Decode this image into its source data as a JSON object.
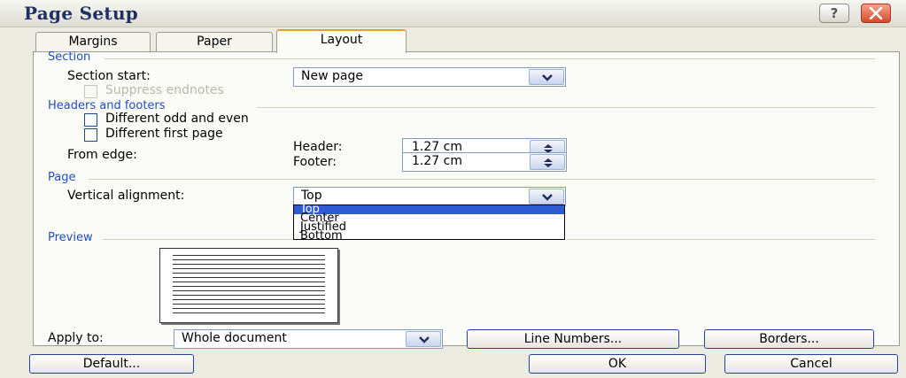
{
  "window": {
    "title": "Page Setup",
    "help_icon": "?"
  },
  "tabs": [
    {
      "label": "Margins"
    },
    {
      "label": "Paper"
    },
    {
      "label": "Layout"
    }
  ],
  "section": {
    "title": "Section",
    "section_start_label": "Section start:",
    "section_start_value": "New page",
    "suppress_endnotes_label": "Suppress endnotes"
  },
  "headers_footers": {
    "title": "Headers and footers",
    "odd_even_label": "Different odd and even",
    "first_page_label": "Different first page",
    "from_edge_label": "From edge:",
    "header_label": "Header:",
    "header_value": "1.27 cm",
    "footer_label": "Footer:",
    "footer_value": "1.27 cm"
  },
  "page": {
    "title": "Page",
    "vertical_alignment_label": "Vertical alignment:",
    "vertical_alignment_value": "Top",
    "options": [
      "Top",
      "Center",
      "Justified",
      "Bottom"
    ]
  },
  "preview": {
    "title": "Preview",
    "apply_to_label": "Apply to:",
    "apply_to_value": "Whole document",
    "line_numbers_button": "Line Numbers...",
    "borders_button": "Borders..."
  },
  "footer_buttons": {
    "default": "Default...",
    "ok": "OK",
    "cancel": "Cancel"
  },
  "colors": {
    "group_heading": "#1f4fc4",
    "selection": "#2f5bd3",
    "active_tab_accent": "#e79b3b"
  }
}
